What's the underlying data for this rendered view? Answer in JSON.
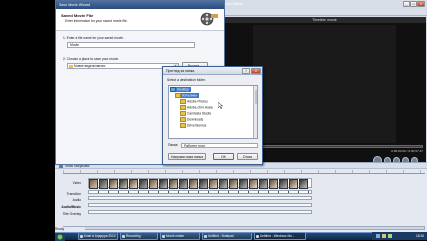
{
  "movie_maker": {
    "title": "Save Movie Wizard",
    "top_right_title": "Windows Movie Maker",
    "preview_title": "Timeline: movie",
    "time_display": "0:00:00.00 / 0:00:57.47",
    "show_storyboard": "Show Storyboard",
    "tracks": [
      "Video",
      "Transition",
      "Audio",
      "Audio/Music",
      "Title Overlay"
    ]
  },
  "save_wizard": {
    "heading": "Saved Movie File",
    "subheading": "Enter information for your saved movie file.",
    "step1_label": "1. Enter a file name for your saved movie.",
    "file_name_value": "Movie",
    "step2_label": "2. Choose a place to save your movie.",
    "location_value": "Мовие видеоклиповс",
    "browse_label": "Browse..."
  },
  "browse_dialog": {
    "title": "Преглед за папка",
    "help_icon_label": "?",
    "close_label": "X",
    "instruction": "Select a destination folder.",
    "tree": [
      {
        "label": "Desktop",
        "level": 0,
        "selected": true
      },
      {
        "label": "Изпълнен",
        "level": 1,
        "selected": true
      },
      {
        "label": "Adobe Photos",
        "level": 2
      },
      {
        "label": "Adobe.cfrm.Нова",
        "level": 2
      },
      {
        "label": "Camtasia Studio",
        "level": 2
      },
      {
        "label": "Downloads",
        "level": 2
      },
      {
        "label": "DriverGenius",
        "level": 2
      }
    ],
    "folder_label": "Папка:",
    "folder_value": "Работен плот",
    "new_folder_button": "Направи нова папка",
    "ok_button": "OK",
    "cancel_button": "Отказ"
  },
  "taskbar": {
    "start_label": "start",
    "tasks": [
      "Клип в Андорра 2012",
      "Recording",
      "Movie maker",
      "Untitled - Notepad",
      "Untitled - Windows Mo..."
    ],
    "clock": "18:26"
  },
  "status": {
    "ready": "Ready"
  }
}
